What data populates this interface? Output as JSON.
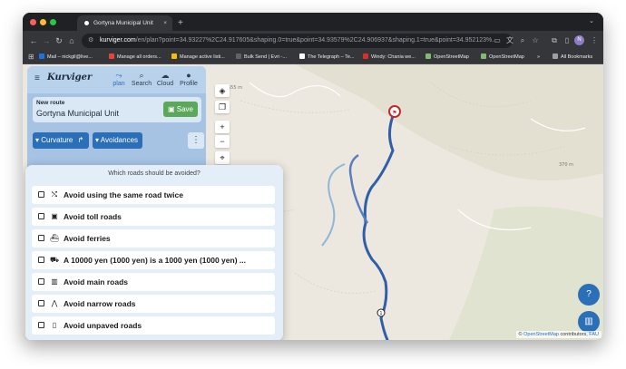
{
  "browser": {
    "tab_title": "Gortyna Municipal Unit",
    "tab_close": "×",
    "new_tab": "+",
    "url_host": "kurviger.com",
    "url_path": "/en/plan?point=34.93227%2C24.917605&shaping.0=true&point=34.93579%2C24.906937&shaping.1=true&point=34.952123%...",
    "profile_initial": "N",
    "bookmarks": [
      {
        "label": "Mail – nickgil@live...",
        "color": "#1a73e8"
      },
      {
        "label": "Manage all orders...",
        "color": "#ea4335"
      },
      {
        "label": "Manage active listi...",
        "color": "#fbbc04"
      },
      {
        "label": "Bulk Send | Evri -...",
        "color": "#5f6368"
      },
      {
        "label": "The Telegraph – Te...",
        "color": "#ffffff"
      },
      {
        "label": "Windy: Chania we...",
        "color": "#d93025"
      },
      {
        "label": "OpenStreetMap",
        "color": "#7ebc6f"
      },
      {
        "label": "OpenStreetMap",
        "color": "#7ebc6f"
      }
    ],
    "bookmarks_more": "»",
    "all_bookmarks": "All Bookmarks"
  },
  "app": {
    "logo": "Kurviger",
    "nav": [
      {
        "label": "plan",
        "icon": "route-icon",
        "active": true
      },
      {
        "label": "Search",
        "icon": "search-icon",
        "active": false
      },
      {
        "label": "Cloud",
        "icon": "cloud-icon",
        "active": false
      },
      {
        "label": "Profile",
        "icon": "person-icon",
        "active": false
      }
    ],
    "route": {
      "heading": "New route",
      "name": "Gortyna Municipal Unit",
      "save_label": "Save"
    },
    "curvature_label": "Curvature",
    "avoidances_label": "Avoidances",
    "kebab": "⋮"
  },
  "map": {
    "elevation_labels": [
      "555 m",
      "370 m"
    ],
    "zoom_in": "+",
    "zoom_out": "−",
    "attribution_prefix": "©",
    "attribution_link": "OpenStreetMap",
    "attribution_middle": "contributors,",
    "attribution_fau": "FAU",
    "fab_help": "?",
    "fab_chart": "▥",
    "waypoint_label": "1"
  },
  "dialog": {
    "title": "Which roads should be avoided?",
    "options": [
      {
        "label": "Avoid using the same road twice",
        "icon": "shuffle-icon",
        "checked": false
      },
      {
        "label": "Avoid toll roads",
        "icon": "money-icon",
        "checked": false
      },
      {
        "label": "Avoid ferries",
        "icon": "ferry-icon",
        "checked": false
      },
      {
        "label": "A 10000 yen (1000 yen) is a 1000 yen (1000 yen) ...",
        "icon": "car-icon",
        "checked": false
      },
      {
        "label": "Avoid main roads",
        "icon": "road-icon",
        "checked": false
      },
      {
        "label": "Avoid narrow roads",
        "icon": "narrow-road-icon",
        "checked": false
      },
      {
        "label": "Avoid unpaved roads",
        "icon": "phone-icon",
        "checked": false
      }
    ]
  }
}
